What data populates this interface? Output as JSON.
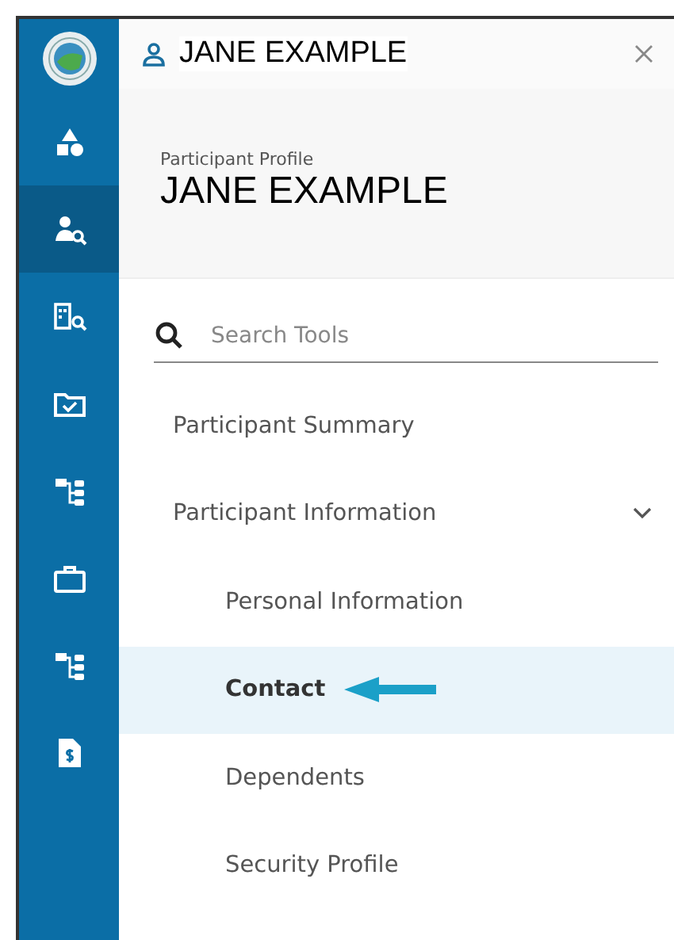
{
  "header": {
    "user_name": "JANE EXAMPLE"
  },
  "profile": {
    "label": "Participant Profile",
    "name": "JANE EXAMPLE"
  },
  "search": {
    "placeholder": "Search Tools"
  },
  "rail": [
    {
      "kind": "shapes",
      "selected": false
    },
    {
      "kind": "person-search",
      "selected": true
    },
    {
      "kind": "building-search",
      "selected": false
    },
    {
      "kind": "folder-check",
      "selected": false
    },
    {
      "kind": "hierarchy",
      "selected": false
    },
    {
      "kind": "briefcase",
      "selected": false
    },
    {
      "kind": "hierarchy",
      "selected": false
    },
    {
      "kind": "document-dollar",
      "selected": false
    }
  ],
  "menu": [
    {
      "label": "Participant Summary",
      "selected": false
    },
    {
      "label": "Participant Information",
      "selected": false,
      "expanded": true,
      "children": [
        {
          "label": "Personal Information",
          "selected": false
        },
        {
          "label": "Contact",
          "selected": true,
          "pointed": true
        },
        {
          "label": "Dependents",
          "selected": false
        },
        {
          "label": "Security Profile",
          "selected": false
        }
      ]
    }
  ]
}
